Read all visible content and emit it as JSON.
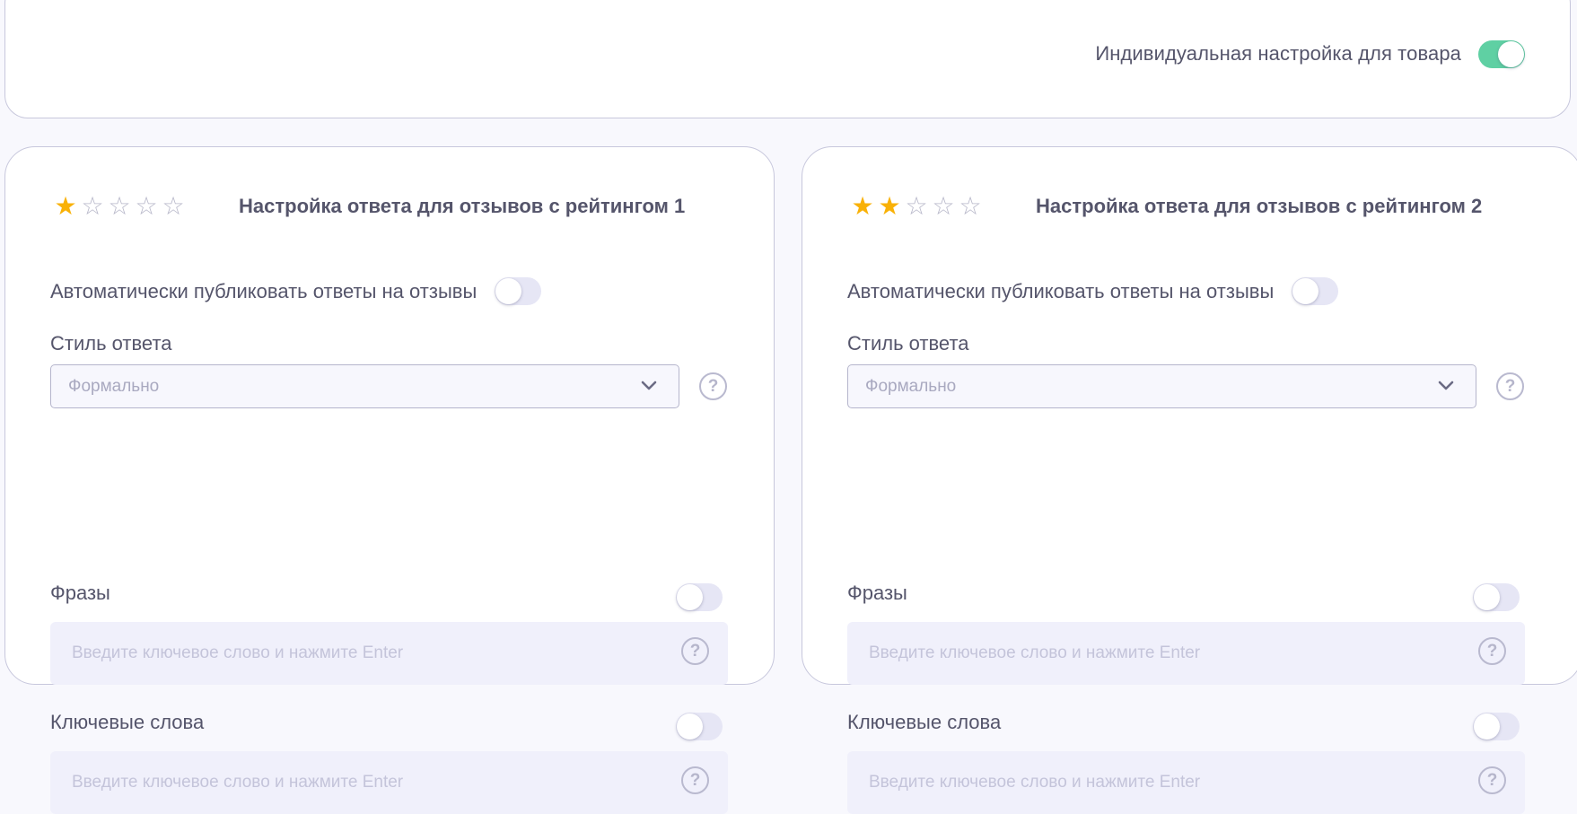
{
  "individual": {
    "label": "Индивидуальная настройка для товара",
    "enabled": true
  },
  "colors": {
    "accent_green": "#5fd0a3",
    "star_filled": "#f9b106",
    "star_empty": "#b6b6c8",
    "text": "#55556b"
  },
  "cards": [
    {
      "rating": 1,
      "max_rating": 5,
      "title": "Настройка ответа для отзывов с рейтингом 1",
      "auto_publish_label": "Автоматически публиковать ответы на отзывы",
      "auto_publish_enabled": false,
      "style_label": "Стиль ответа",
      "style_value": "Формально",
      "phrases_label": "Фразы",
      "phrases_enabled": false,
      "phrases_placeholder": "Введите ключевое слово и нажмите Enter",
      "keywords_label": "Ключевые слова",
      "keywords_enabled": false,
      "keywords_placeholder": "Введите ключевое слово и нажмите Enter"
    },
    {
      "rating": 2,
      "max_rating": 5,
      "title": "Настройка ответа для отзывов с рейтингом 2",
      "auto_publish_label": "Автоматически публиковать ответы на отзывы",
      "auto_publish_enabled": false,
      "style_label": "Стиль ответа",
      "style_value": "Формально",
      "phrases_label": "Фразы",
      "phrases_enabled": false,
      "phrases_placeholder": "Введите ключевое слово и нажмите Enter",
      "keywords_label": "Ключевые слова",
      "keywords_enabled": false,
      "keywords_placeholder": "Введите ключевое слово и нажмите Enter"
    }
  ]
}
